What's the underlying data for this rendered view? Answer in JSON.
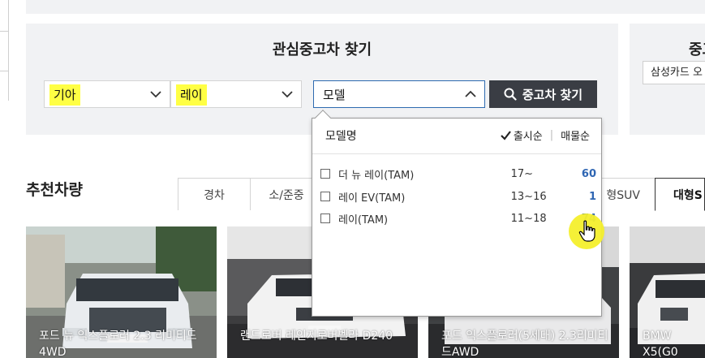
{
  "search": {
    "title": "관심중고차 찾기",
    "maker_value": "기아",
    "model_value": "레이",
    "detail_value": "모델",
    "button_label": "중고차 찾기"
  },
  "side": {
    "title": "중고",
    "card_label": "삼성카드 오"
  },
  "dropdown": {
    "header_label": "모델명",
    "sort_release": "출시순",
    "sort_count": "매물순",
    "rows": [
      {
        "name": "더 뉴 레이(TAM)",
        "years": "17~",
        "count": "60"
      },
      {
        "name": "레이 EV(TAM)",
        "years": "13~16",
        "count": "1"
      },
      {
        "name": "레이(TAM)",
        "years": "11~18",
        "count": "74"
      }
    ]
  },
  "recommend": {
    "title": "추천차량",
    "tabs": [
      "경차",
      "소/준중",
      "형SUV",
      "대형S"
    ]
  },
  "cards": [
    {
      "label": "포드 뉴 익스플로러 2.3 리미티드 4WD"
    },
    {
      "label": "랜드로버 레인지로버벨라 D240"
    },
    {
      "label": "포드 익스플로러(5세대) 2.3리미티드AWD"
    },
    {
      "label": "BMW X5(G0"
    }
  ],
  "colors": {
    "highlight": "#ffff44",
    "accent_blue": "#2f66b3",
    "button_dark": "#3a3d44"
  }
}
